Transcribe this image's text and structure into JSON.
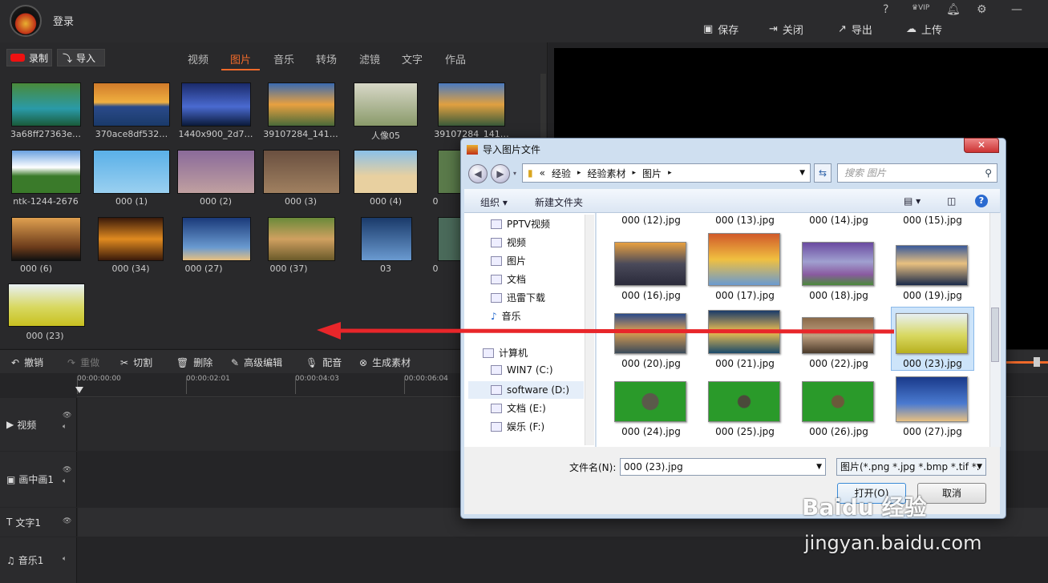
{
  "app": {
    "login": "登录",
    "top_icons": [
      "?",
      "VIP",
      "bell",
      "gear",
      "—"
    ],
    "actions": [
      {
        "label": "保存",
        "icon": "save-icon"
      },
      {
        "label": "关闭",
        "icon": "close-icon"
      },
      {
        "label": "导出",
        "icon": "export-icon"
      },
      {
        "label": "上传",
        "icon": "upload-icon"
      }
    ]
  },
  "library": {
    "record": "录制",
    "import": "导入",
    "tabs": [
      "视频",
      "图片",
      "音乐",
      "转场",
      "滤镜",
      "文字",
      "作品"
    ],
    "active_tab": "图片",
    "items": [
      "3a68ff27363e…",
      "370ace8df532…",
      "1440x900_2d7…",
      "39107284_141…",
      "人像05",
      "39107284_141…",
      "ntk-1244-2676",
      "000 (1)",
      "000 (2)",
      "000 (3)",
      "000 (4)",
      "0",
      "000 (6)",
      "000 (34)",
      "000 (27)",
      "000 (37)",
      "03",
      "0",
      "000 (23)"
    ]
  },
  "toolbar": {
    "undo": "撤销",
    "redo": "重做",
    "cut": "切割",
    "delete": "删除",
    "advanced": "高级编辑",
    "dub": "配音",
    "generate": "生成素材"
  },
  "timeline": {
    "ticks": [
      "00:00:00:00",
      "00:00:02:01",
      "00:00:04:03",
      "00:00:06:04"
    ],
    "tracks": [
      {
        "label": "视频"
      },
      {
        "label": "画中画1"
      },
      {
        "label": "文字1"
      },
      {
        "label": "音乐1"
      }
    ]
  },
  "dialog": {
    "title": "导入图片文件",
    "breadcrumb": [
      "«",
      "经验",
      "经验素材",
      "图片"
    ],
    "search_placeholder": "搜索 图片",
    "organize": "组织 ▾",
    "new_folder": "新建文件夹",
    "nav": [
      "PPTV视频",
      "视频",
      "图片",
      "文档",
      "迅雷下载",
      "音乐",
      "计算机",
      "WIN7 (C:)",
      "software (D:)",
      "文档 (E:)",
      "娱乐 (F:)"
    ],
    "files_top": [
      "000 (12).jpg",
      "000 (13).jpg",
      "000 (14).jpg",
      "000 (15).jpg"
    ],
    "files": [
      "000 (16).jpg",
      "000 (17).jpg",
      "000 (18).jpg",
      "000 (19).jpg",
      "000 (20).jpg",
      "000 (21).jpg",
      "000 (22).jpg",
      "000 (23).jpg",
      "000 (24).jpg",
      "000 (25).jpg",
      "000 (26).jpg",
      "000 (27).jpg"
    ],
    "filename_label": "文件名(N):",
    "filename_value": "000 (23).jpg",
    "filetype": "图片(*.png *.jpg *.bmp *.tif *.",
    "open": "打开(O)",
    "cancel": "取消"
  },
  "watermark": {
    "brand": "Baidu 经验",
    "url": "jingyan.baidu.com"
  }
}
